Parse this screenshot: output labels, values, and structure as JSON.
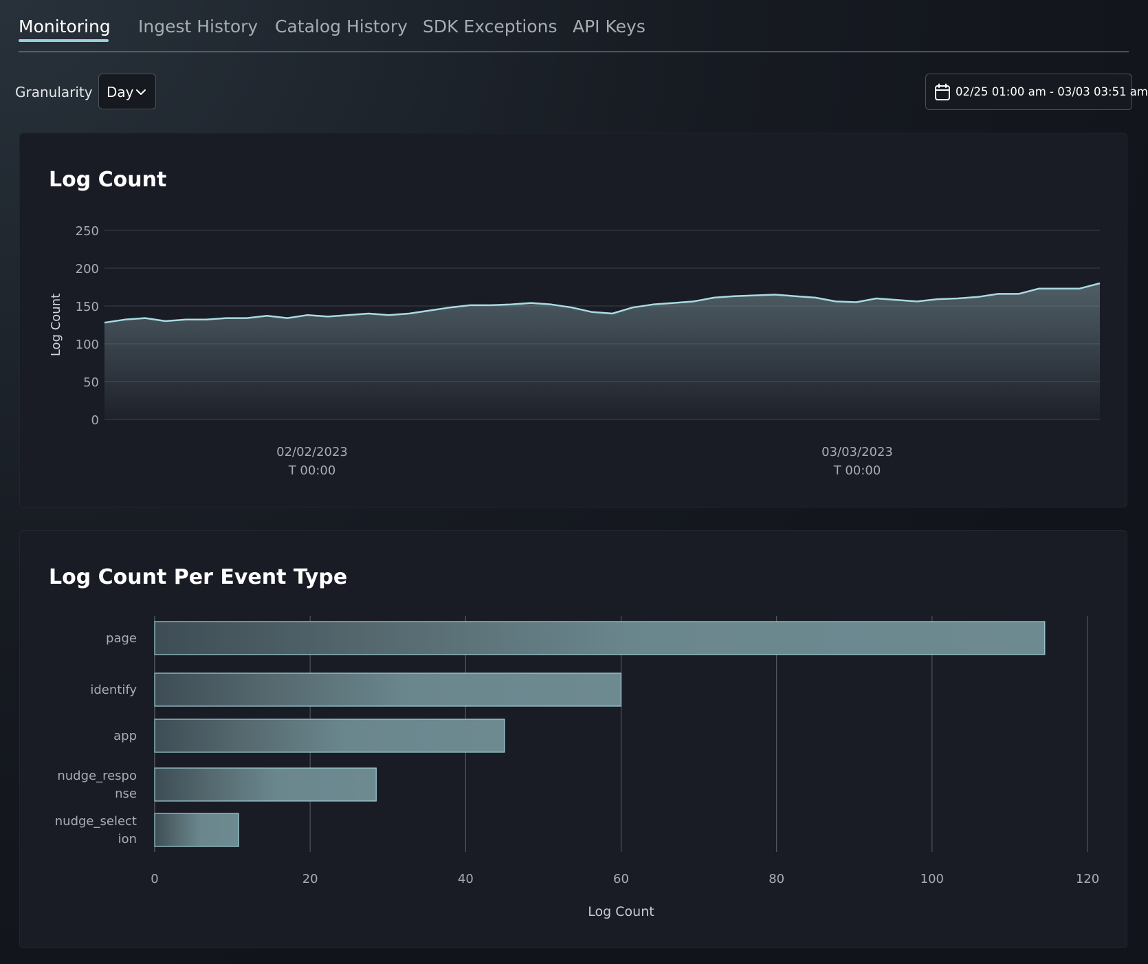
{
  "tabs": [
    {
      "label": "Monitoring",
      "active": true
    },
    {
      "label": "Ingest History",
      "active": false
    },
    {
      "label": "Catalog History",
      "active": false
    },
    {
      "label": "SDK Exceptions",
      "active": false
    },
    {
      "label": "API Keys",
      "active": false
    }
  ],
  "toolbar": {
    "granularity_label": "Granularity",
    "granularity_value": "Day",
    "date_range": "02/25 01:00 am - 03/03 03:51 am"
  },
  "colors": {
    "accent": "#9ad0db",
    "line": "#a9dbe3",
    "panel": "#1a1c25",
    "bar_fill": "#6e8a91"
  },
  "charts": {
    "log_count": {
      "title": "Log Count"
    },
    "per_event": {
      "title": "Log Count Per Event Type"
    }
  },
  "chart_data": [
    {
      "type": "area",
      "title": "Log Count",
      "ylabel": "Log Count",
      "xlabel": "",
      "ylim": [
        0,
        250
      ],
      "yticks": [
        0,
        50,
        100,
        150,
        200,
        250
      ],
      "xticks": [
        {
          "line1": "02/02/2023",
          "line2": "T 00:00"
        },
        {
          "line1": "03/03/2023",
          "line2": "T 00:00"
        }
      ],
      "grid": true,
      "y": [
        128,
        132,
        134,
        130,
        132,
        132,
        134,
        134,
        137,
        134,
        138,
        136,
        138,
        140,
        138,
        140,
        144,
        148,
        151,
        151,
        152,
        154,
        152,
        148,
        142,
        140,
        148,
        152,
        154,
        156,
        161,
        163,
        164,
        165,
        163,
        161,
        156,
        155,
        160,
        158,
        156,
        159,
        160,
        162,
        166,
        166,
        173,
        173,
        173,
        180
      ]
    },
    {
      "type": "bar",
      "orientation": "horizontal",
      "title": "Log Count Per Event Type",
      "xlabel": "Log Count",
      "ylabel": "",
      "xlim": [
        0,
        120
      ],
      "xticks": [
        0,
        20,
        40,
        60,
        80,
        100,
        120
      ],
      "grid": true,
      "categories": [
        {
          "lines": [
            "page"
          ],
          "value": 114.5
        },
        {
          "lines": [
            "identify"
          ],
          "value": 60
        },
        {
          "lines": [
            "app"
          ],
          "value": 45
        },
        {
          "lines": [
            "nudge_respo",
            "nse"
          ],
          "value": 28.5
        },
        {
          "lines": [
            "nudge_select",
            "ion"
          ],
          "value": 10.8
        }
      ]
    }
  ]
}
